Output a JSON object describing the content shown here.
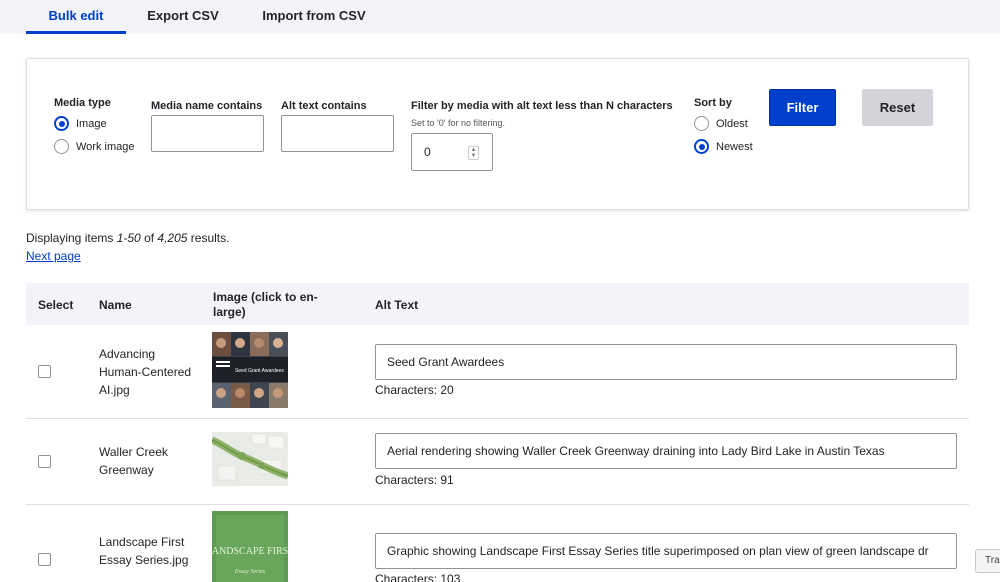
{
  "tabs": [
    {
      "label": "Bulk edit",
      "active": true
    },
    {
      "label": "Export CSV",
      "active": false
    },
    {
      "label": "Import from CSV",
      "active": false
    }
  ],
  "filters": {
    "media_type": {
      "label": "Media type",
      "options": [
        {
          "label": "Image",
          "selected": true
        },
        {
          "label": "Work image",
          "selected": false
        }
      ]
    },
    "media_name": {
      "label": "Media name contains",
      "value": ""
    },
    "alt_text": {
      "label": "Alt text contains",
      "value": ""
    },
    "alt_length": {
      "label": "Filter by media with alt text less than N characters",
      "hint": "Set to '0' for no filtering.",
      "value": "0"
    },
    "sort_by": {
      "label": "Sort by",
      "options": [
        {
          "label": "Oldest",
          "selected": false
        },
        {
          "label": "Newest",
          "selected": true
        }
      ]
    },
    "filter_button": "Filter",
    "reset_button": "Reset"
  },
  "summary": {
    "prefix": "Displaying items ",
    "range": "1-50",
    "middle": " of ",
    "total": "4,205",
    "suffix": " results."
  },
  "next_page": "Next page",
  "table": {
    "headers": [
      "Select",
      "Name",
      "Image (click to en-large)",
      "Alt Text"
    ],
    "rows": [
      {
        "name": "Advancing Human-Centered AI.jpg",
        "alt_text": "Seed Grant Awardees",
        "chars": "Characters: 20",
        "thumb_title": "Seed Grant Awardees"
      },
      {
        "name": "Waller Creek Greenway",
        "alt_text": "Aerial rendering showing Waller Creek Greenway draining into Lady Bird Lake in Austin Texas",
        "chars": "Characters: 91"
      },
      {
        "name": "Landscape First Essay Series.jpg",
        "alt_text": "Graphic showing Landscape First Essay Series title superimposed on plan view of green landscape dr",
        "chars": "Characters: 103",
        "thumb_title": "LANDSCAPE FIRST",
        "thumb_subtitle": "Essay Series"
      }
    ]
  },
  "translate_button": "Tra",
  "colors": {
    "accent": "#003ecc",
    "header_bg": "#f3f4f9",
    "reset_bg": "#d3d4d9"
  }
}
